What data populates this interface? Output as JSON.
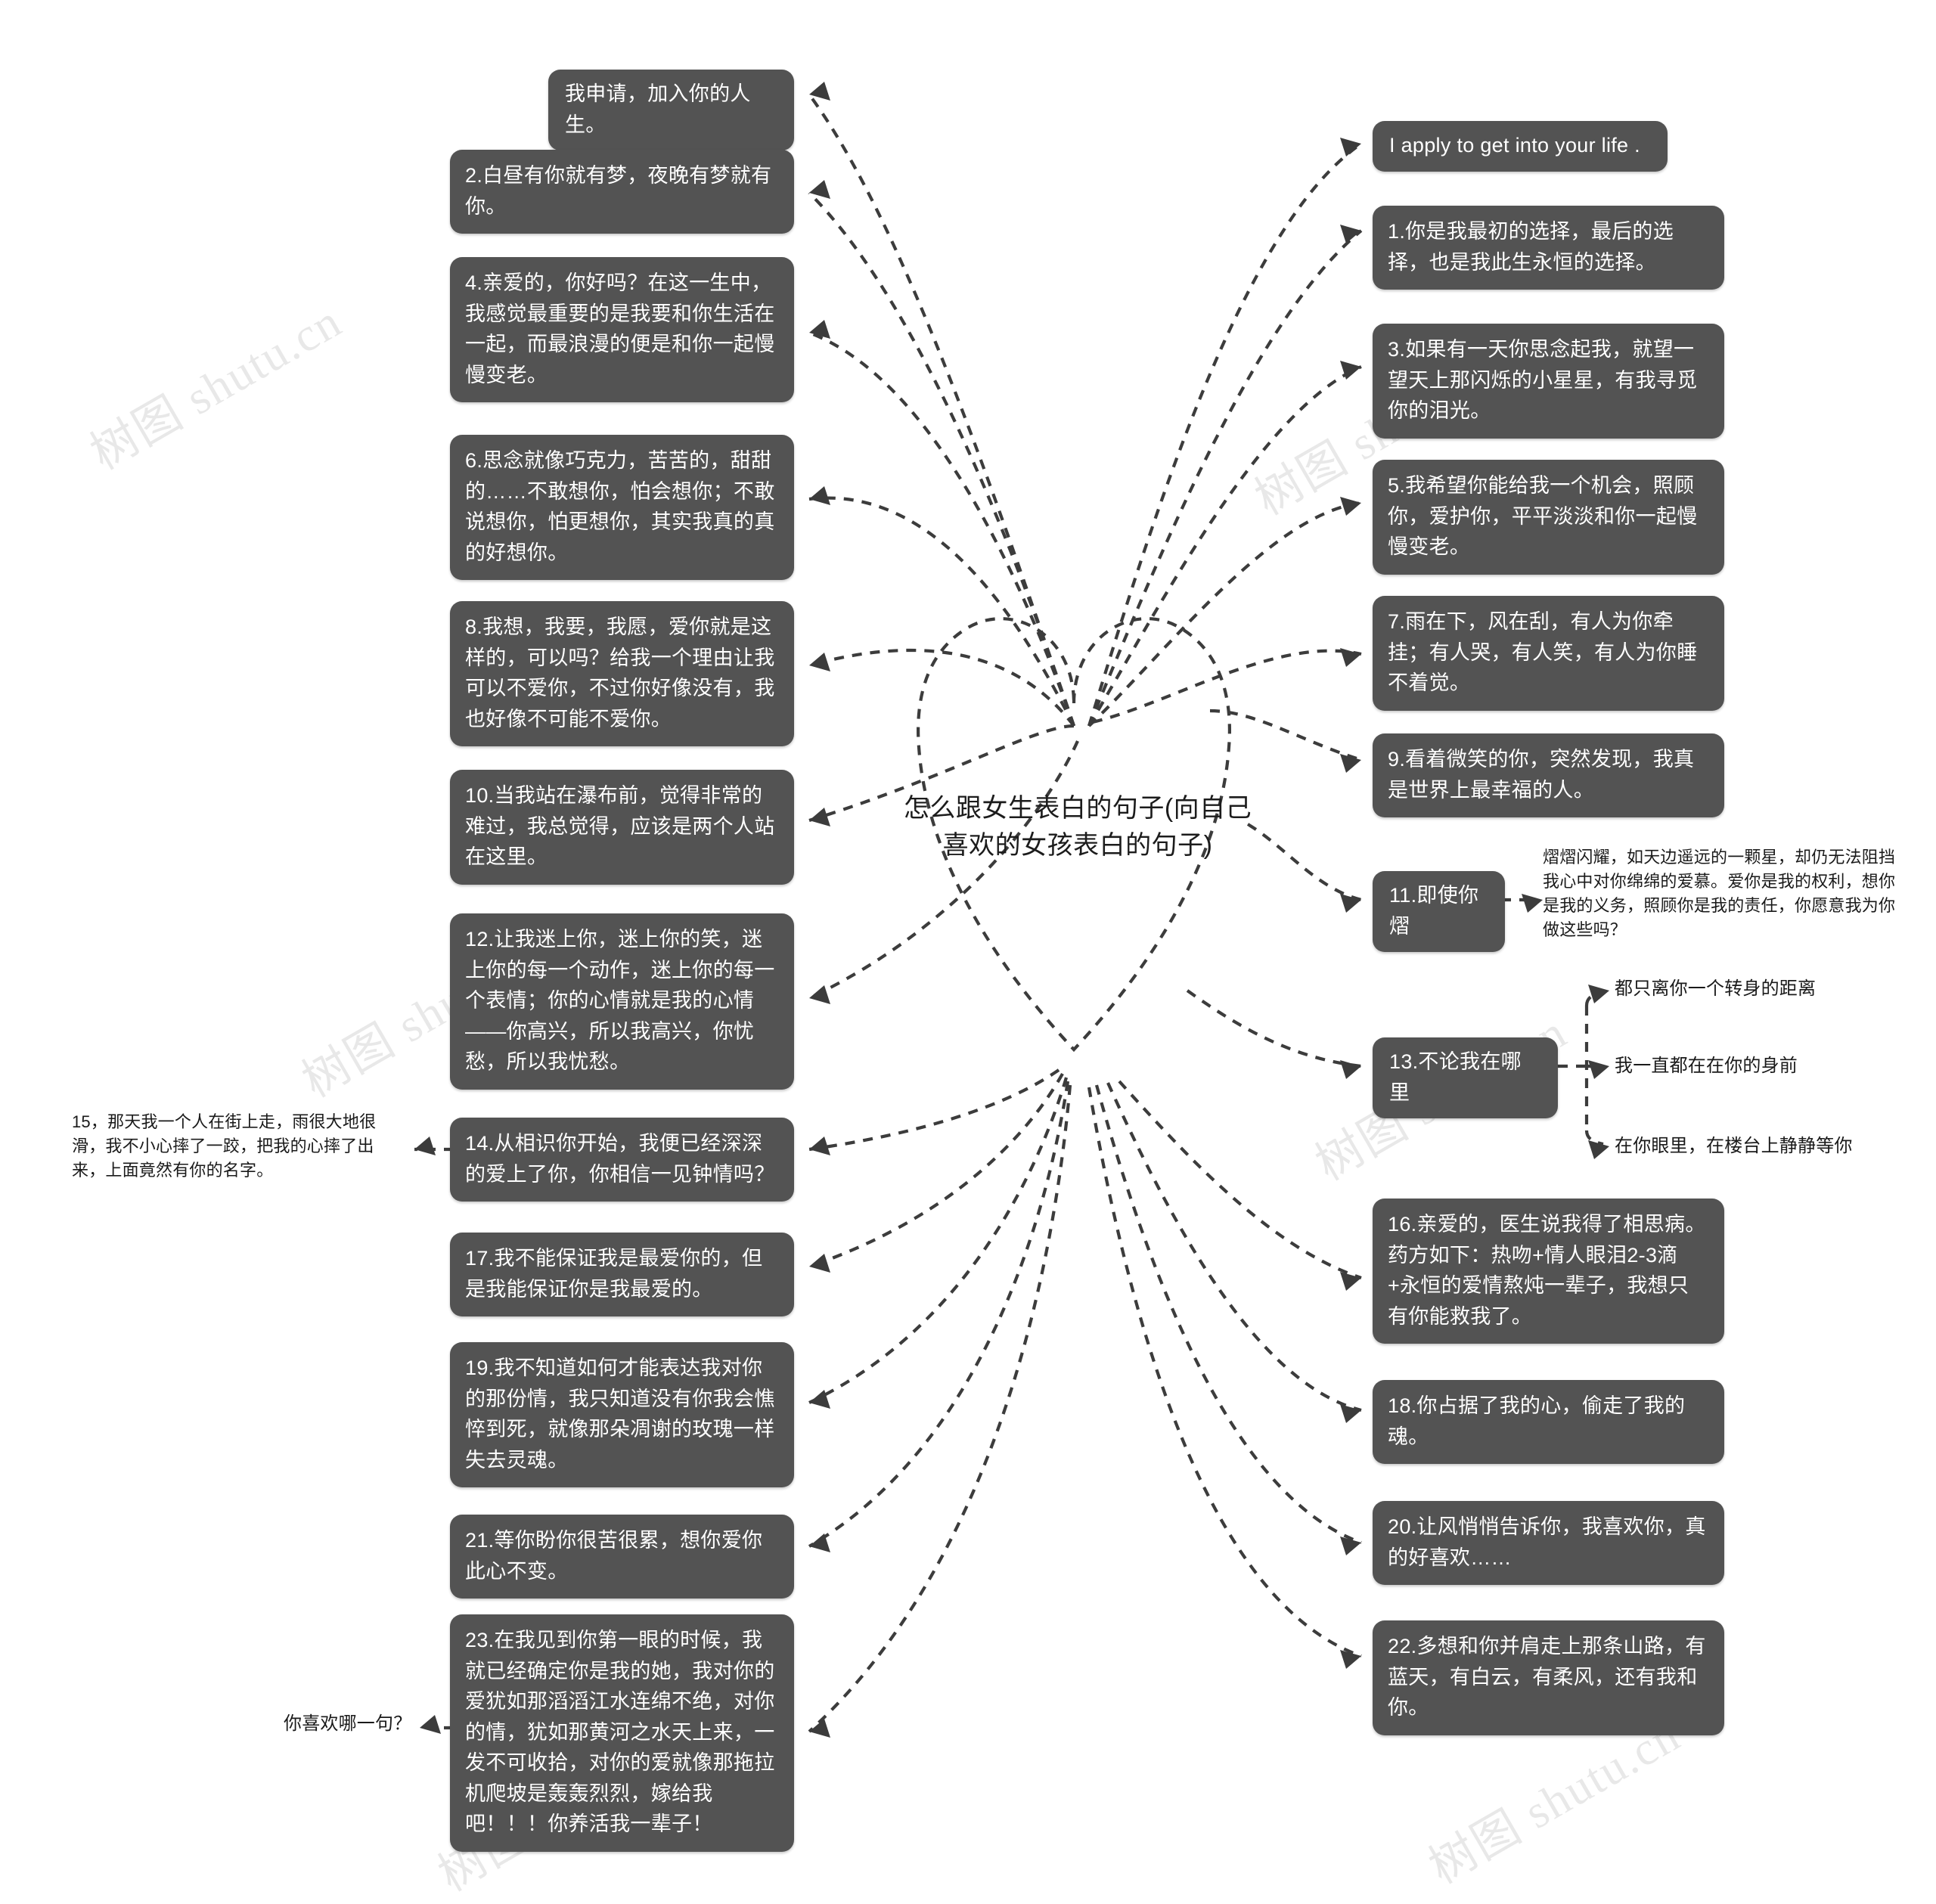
{
  "title": "怎么跟女生表白的句子(向自己喜欢的女孩表白的句子)",
  "colors": {
    "node_bg": "#535353",
    "node_text": "#ffffff",
    "link": "#3c3c3c",
    "heart_outline": "#2f6fae",
    "page_bg": "#ffffff",
    "watermark": "#000000"
  },
  "watermark": {
    "text": "树图 shutu.cn"
  },
  "center": {
    "shape": "heart",
    "label": "怎么跟女生表白的句子(向自己喜欢的女孩表白的句子)"
  },
  "left_branches": [
    {
      "id": "l1",
      "text": "我申请，加入你的人生。"
    },
    {
      "id": "l2",
      "text": "2.白昼有你就有梦，夜晚有梦就有你。"
    },
    {
      "id": "l3",
      "text": "4.亲爱的，你好吗？在这一生中，我感觉最重要的是我要和你生活在一起，而最浪漫的便是和你一起慢慢变老。"
    },
    {
      "id": "l4",
      "text": "6.思念就像巧克力，苦苦的，甜甜的……不敢想你，怕会想你；不敢说想你，怕更想你，其实我真的真的好想你。"
    },
    {
      "id": "l5",
      "text": "8.我想，我要，我愿，爱你就是这样的，可以吗？给我一个理由让我可以不爱你，不过你好像没有，我也好像不可能不爱你。"
    },
    {
      "id": "l6",
      "text": "10.当我站在瀑布前，觉得非常的难过，我总觉得，应该是两个人站在这里。"
    },
    {
      "id": "l7",
      "text": "12.让我迷上你，迷上你的笑，迷上你的每一个动作，迷上你的每一个表情；你的心情就是我的心情——你高兴，所以我高兴，你忧愁，所以我忧愁。"
    },
    {
      "id": "l8",
      "text": "14.从相识你开始，我便已经深深的爱上了你，你相信一见钟情吗？"
    },
    {
      "id": "l9",
      "text": "17.我不能保证我是最爱你的，但是我能保证你是我最爱的。"
    },
    {
      "id": "l10",
      "text": "19.我不知道如何才能表达我对你的那份情，我只知道没有你我会憔悴到死，就像那朵凋谢的玫瑰一样失去灵魂。"
    },
    {
      "id": "l11",
      "text": "21.等你盼你很苦很累，想你爱你此心不变。"
    },
    {
      "id": "l12",
      "text": "23.在我见到你第一眼的时候，我就已经确定你是我的她，我对你的爱犹如那滔滔江水连绵不绝，对你的情，犹如那黄河之水天上来，一发不可收拾，对你的爱就像那拖拉机爬坡是轰轰烈烈，嫁给我吧！！！你养活我一辈子！"
    }
  ],
  "left_plain": [
    {
      "id": "p15",
      "text": "15，那天我一个人在街上走，雨很大地很滑，我不小心摔了一跤，把我的心摔了出来，上面竟然有你的名字。",
      "parent": "l8"
    },
    {
      "id": "pq",
      "text": "你喜欢哪一句？",
      "parent": "l12"
    }
  ],
  "right_branches": [
    {
      "id": "r1",
      "text": "I apply to get into your life ."
    },
    {
      "id": "r2",
      "text": "1.你是我最初的选择，最后的选择，也是我此生永恒的选择。"
    },
    {
      "id": "r3",
      "text": "3.如果有一天你思念起我，就望一望天上那闪烁的小星星，有我寻觅你的泪光。"
    },
    {
      "id": "r4",
      "text": "5.我希望你能给我一个机会，照顾你，爱护你，平平淡淡和你一起慢慢变老。"
    },
    {
      "id": "r5",
      "text": "7.雨在下，风在刮，有人为你牵挂；有人哭，有人笑，有人为你睡不着觉。"
    },
    {
      "id": "r6",
      "text": "9.看着微笑的你，突然发现，我真是世界上最幸福的人。"
    },
    {
      "id": "r7",
      "text": "11.即使你熠"
    },
    {
      "id": "r8",
      "text": "13.不论我在哪里"
    },
    {
      "id": "r9",
      "text": "16.亲爱的，医生说我得了相思病。药方如下：热吻+情人眼泪2-3滴+永恒的爱情熬炖一辈子，我想只有你能救我了。"
    },
    {
      "id": "r10",
      "text": "18.你占据了我的心，偷走了我的魂。"
    },
    {
      "id": "r11",
      "text": "20.让风悄悄告诉你，我喜欢你，真的好喜欢……"
    },
    {
      "id": "r12",
      "text": "22.多想和你并肩走上那条山路，有蓝天，有白云，有柔风，还有我和你。"
    }
  ],
  "right_children": {
    "r7": [
      {
        "id": "r7c1",
        "text": "熠熠闪耀，如天边遥远的一颗星，却仍无法阻挡我心中对你绵绵的爱慕。爱你是我的权利，想你是我的义务，照顾你是我的责任，你愿意我为你做这些吗？"
      }
    ],
    "r8": [
      {
        "id": "r8c1",
        "text": "都只离你一个转身的距离"
      },
      {
        "id": "r8c2",
        "text": "我一直都在在你的身前"
      },
      {
        "id": "r8c3",
        "text": "在你眼里，在楼台上静静等你"
      }
    ]
  }
}
